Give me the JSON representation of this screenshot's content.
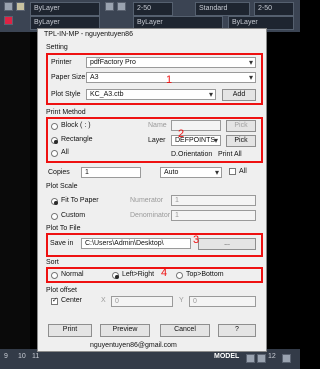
{
  "cad": {
    "layer_label": "ByLayer",
    "linetype_label": "ByLayer",
    "lineweight_label": "ByLayer",
    "scale_top": "2-50",
    "scale_top2": "2-50",
    "style_label": "Standard",
    "status_numbers": [
      "9",
      "10",
      "11",
      "12"
    ],
    "model_label": "MODEL"
  },
  "dialog": {
    "title": "TPL-IN-MP - nguyentuyen86",
    "setting": {
      "section": "Setting",
      "printer_label": "Printer",
      "printer_value": "pdfFactory Pro",
      "paper_label": "Paper Size",
      "paper_value": "A3",
      "plotstyle_label": "Plot Style",
      "plotstyle_value": "KC_A3.ctb",
      "add_button": "Add",
      "marker": "1"
    },
    "print_method": {
      "section": "Print Method",
      "block_label": "Block ( : )",
      "rectangle_label": "Rectangle",
      "all_label": "All",
      "name_label": "Name",
      "pick_label": "Pick",
      "layer_label": "Layer",
      "layer_value": "DEFPOINTS",
      "pick2_label": "Pick",
      "orientation_label": "D.Orientation",
      "print_all_label": "Print All",
      "marker": "2"
    },
    "copies": {
      "label": "Copies",
      "value": "1",
      "auto_value": "Auto",
      "all_label": "All"
    },
    "plot_scale": {
      "section": "Plot Scale",
      "fit_label": "Fit To Paper",
      "custom_label": "Custom",
      "numerator_label": "Numerator",
      "numerator_value": "1",
      "denominator_label": "Denominator",
      "denominator_value": "1"
    },
    "plot_to_file": {
      "section": "Plot To File",
      "save_label": "Save in",
      "save_value": "C:\\Users\\Admin\\Desktop\\",
      "browse_label": "...",
      "marker": "3"
    },
    "sort": {
      "section": "Sort",
      "normal_label": "Normal",
      "lr_label": "Left>Right",
      "tb_label": "Top>Bottom",
      "marker": "4"
    },
    "plot_offset": {
      "section": "Plot offset",
      "center_label": "Center",
      "x_label": "X",
      "x_value": "0",
      "y_label": "Y",
      "y_value": "0"
    },
    "buttons": {
      "print": "Print",
      "preview": "Preview",
      "cancel": "Cancel",
      "help": "?"
    },
    "footer_email": "nguyentuyen86@gmail.com"
  },
  "colors": {
    "highlight": "#ee1111",
    "dialog_bg": "#efefef",
    "cad_bg": "#000000"
  }
}
